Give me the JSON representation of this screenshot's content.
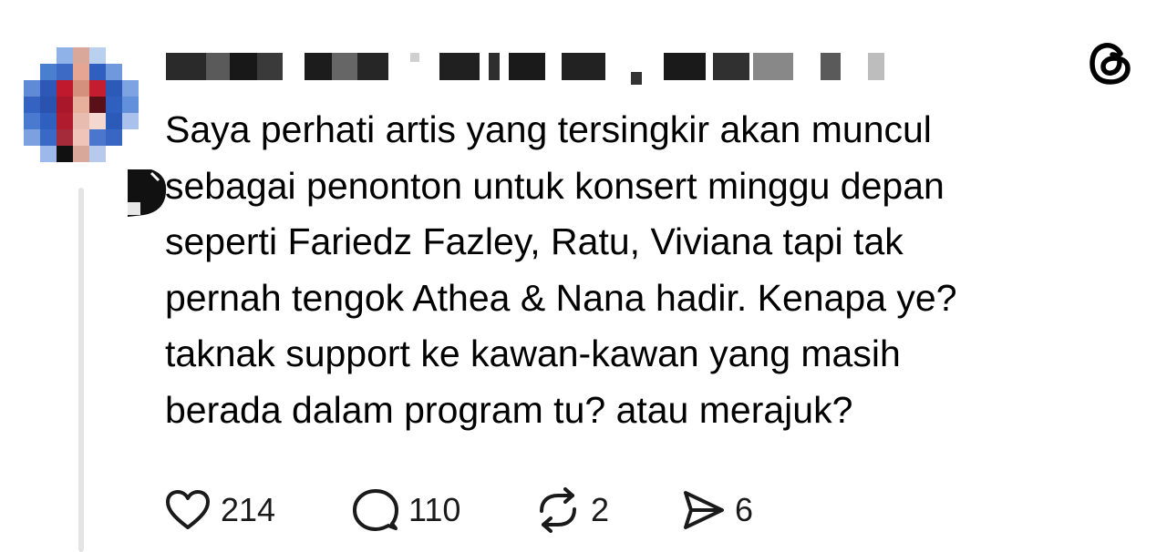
{
  "post": {
    "body_lines": [
      "Saya perhati artis yang tersingkir akan muncul",
      "sebagai penonton untuk konsert minggu depan",
      "seperti Fariedz Fazley, Ratu, Viviana tapi tak",
      "pernah tengok Athea & Nana hadir. Kenapa ye?",
      "taknak support ke kawan-kawan yang masih",
      "berada dalam program tu? atau merajuk?"
    ],
    "actions": {
      "likes": "214",
      "replies": "110",
      "reposts": "2",
      "shares": "6"
    }
  },
  "icons": {
    "brand": "threads-logo-icon",
    "like": "heart-icon",
    "reply": "speech-bubble-icon",
    "repost": "repost-arrows-icon",
    "share": "send-icon"
  },
  "colors": {
    "text": "#000000",
    "thread_line": "#e4e4e4",
    "avatar_blue": "#2f5fbf",
    "avatar_red": "#c0182c"
  }
}
